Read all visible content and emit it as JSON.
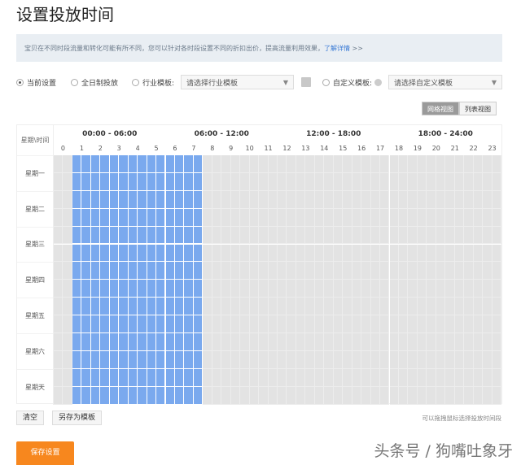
{
  "title": "设置投放时间",
  "info": {
    "text": "宝贝在不同时段流量和转化可能有所不同，您可以针对各时段设置不同的折扣出价，提高流量利用效果，",
    "link": "了解详情",
    "arrow": " >>"
  },
  "options": {
    "current": "当前设置",
    "allday": "全日制投放",
    "industry": "行业模板:",
    "industry_select": "请选择行业模板",
    "custom": "自定义模板:",
    "custom_select": "请选择自定义模板",
    "selected": "current"
  },
  "views": {
    "grid": "网格视图",
    "list": "列表视图"
  },
  "grid": {
    "corner": "星期\\时间",
    "ranges": [
      "00:00 - 06:00",
      "06:00 - 12:00",
      "12:00 - 18:00",
      "18:00 - 24:00"
    ],
    "hours": [
      "0",
      "1",
      "2",
      "3",
      "4",
      "5",
      "6",
      "7",
      "8",
      "9",
      "10",
      "11",
      "12",
      "13",
      "14",
      "15",
      "16",
      "17",
      "18",
      "19",
      "20",
      "21",
      "22",
      "23"
    ],
    "days": [
      "星期一",
      "星期二",
      "星期三",
      "星期四",
      "星期五",
      "星期六",
      "星期天"
    ],
    "selected_hours": {
      "start": 1,
      "end": 8
    }
  },
  "actions": {
    "clear": "清空",
    "save_template": "另存为模板",
    "hint": "可以拖拽鼠标选择投放时间段",
    "save": "保存设置"
  },
  "watermark": "头条号 / 狗嘴吐象牙",
  "colors": {
    "selected": "#7aa9ee",
    "unselected": "#e3e3e3",
    "save": "#f7871e"
  }
}
